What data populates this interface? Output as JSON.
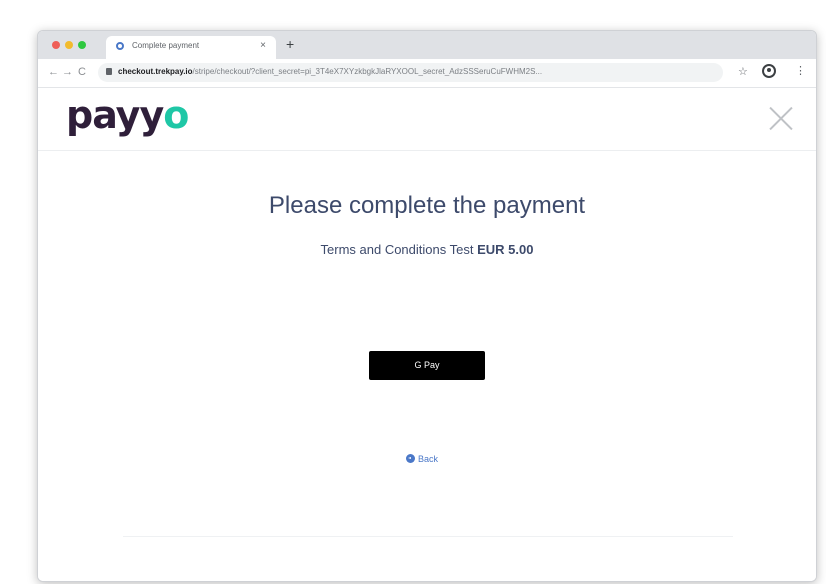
{
  "browser": {
    "tab_title": "Complete payment",
    "tab_close": "×",
    "new_tab": "+",
    "nav_back": "←",
    "nav_forward": "→",
    "nav_reload": "C",
    "url_domain": "checkout.trekpay.io",
    "url_path": "/stripe/checkout/?client_secret=pi_3T4eX7XYzkbgkJlaRYXOOL_secret_AdzSSSeruCuFWHM2S...",
    "bookmark": "☆",
    "menu": "⋮"
  },
  "header": {
    "logo_main": "payy",
    "logo_accent": "o"
  },
  "main": {
    "heading": "Please complete the payment",
    "order_name": "Terms and Conditions Test",
    "order_amount": "EUR 5.00",
    "gpay_label": "G Pay",
    "back_label": "Back"
  }
}
